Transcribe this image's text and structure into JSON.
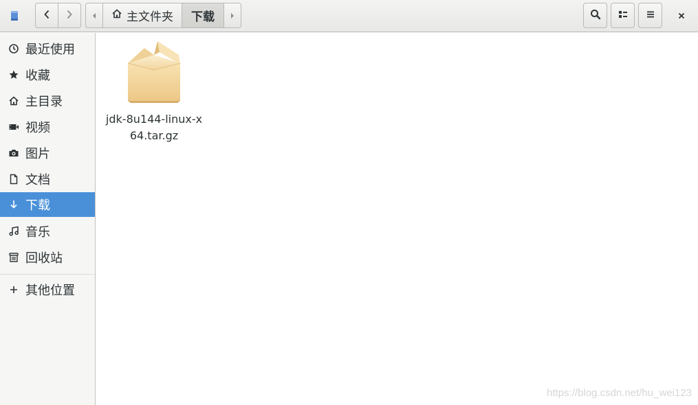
{
  "header": {
    "app_icon": "files-app-icon",
    "back_icon": "chevron-left-icon",
    "forward_icon": "chevron-right-icon",
    "path": [
      {
        "label": "主文件夹",
        "icon": "home-icon"
      },
      {
        "label": "下载"
      }
    ],
    "search_icon": "search-icon",
    "view_options_icon": "view-list-icon",
    "menu_icon": "hamburger-menu-icon",
    "close_icon": "close-icon"
  },
  "sidebar": {
    "items": [
      {
        "label": "最近使用",
        "icon": "clock-icon"
      },
      {
        "label": "收藏",
        "icon": "star-icon"
      },
      {
        "label": "主目录",
        "icon": "home-icon"
      },
      {
        "label": "视频",
        "icon": "video-icon"
      },
      {
        "label": "图片",
        "icon": "camera-icon"
      },
      {
        "label": "文档",
        "icon": "document-icon"
      },
      {
        "label": "下载",
        "icon": "download-icon",
        "active": true
      },
      {
        "label": "音乐",
        "icon": "music-icon"
      },
      {
        "label": "回收站",
        "icon": "trash-icon"
      }
    ],
    "other_locations": {
      "label": "其他位置",
      "icon": "plus-icon"
    }
  },
  "files": [
    {
      "name": "jdk-8u144-linux-x64.tar.gz",
      "icon": "package-icon"
    }
  ],
  "watermark": "https://blog.csdn.net/hu_wei123",
  "colors": {
    "accent": "#4a90d9",
    "sidebar_bg": "#f6f6f5",
    "package_light": "#f6dca4",
    "package_dark": "#e2bd7a"
  }
}
